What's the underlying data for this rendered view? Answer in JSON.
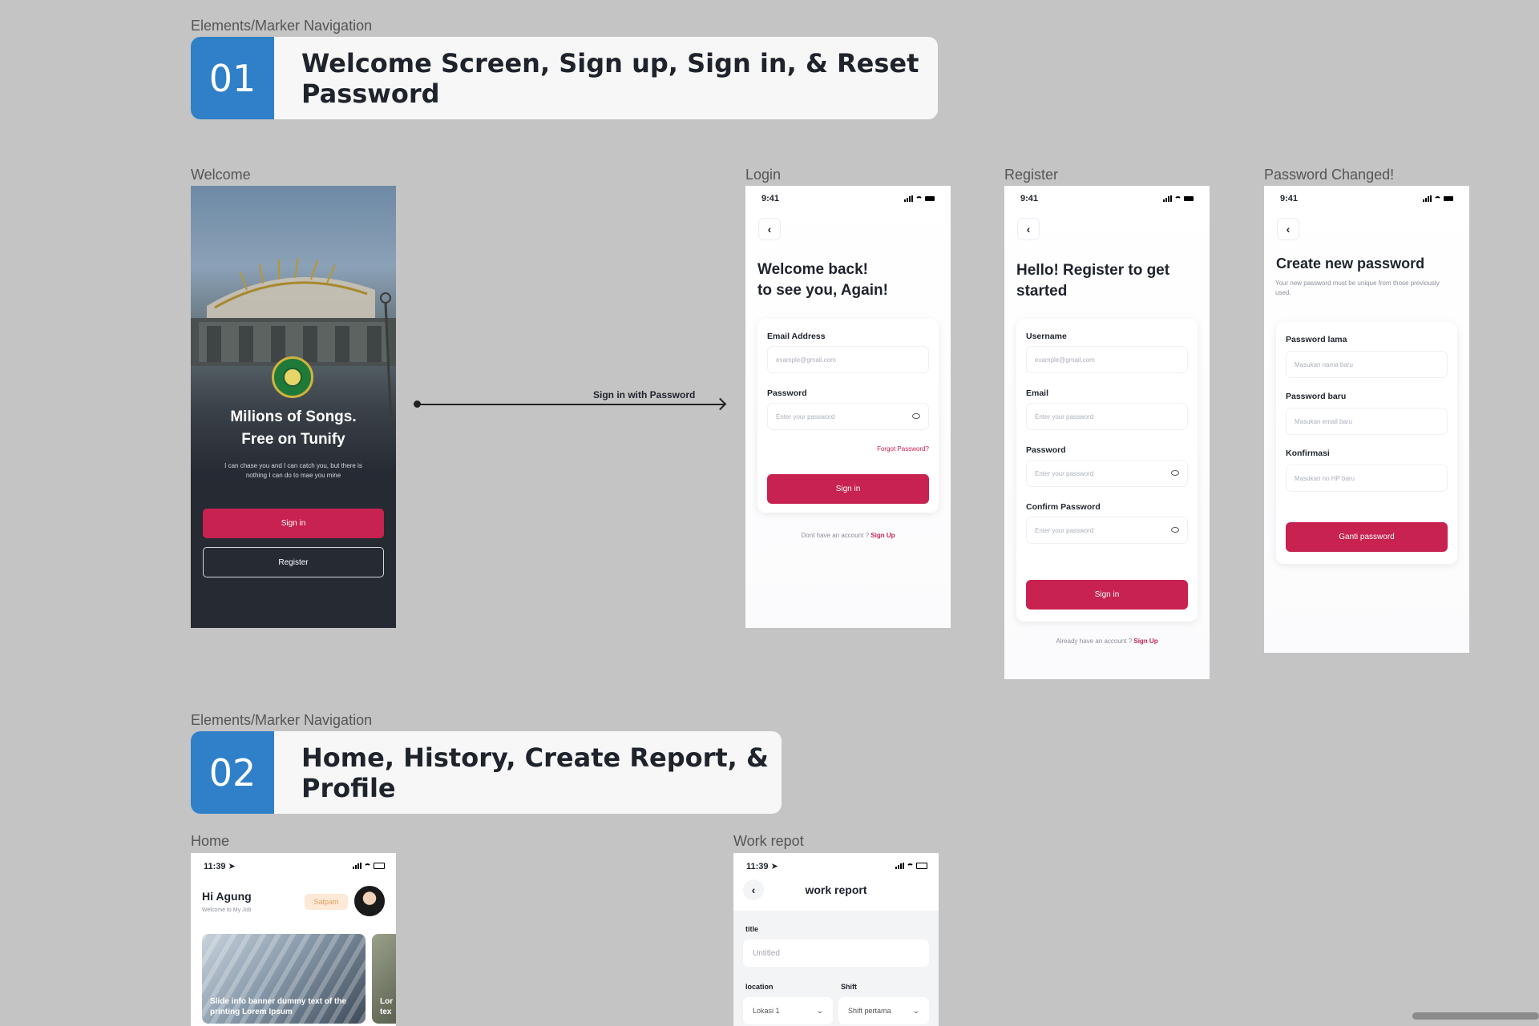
{
  "section1": {
    "label": "Elements/Marker Navigation",
    "number": "01",
    "title": "Welcome Screen, Sign up, Sign in, & Reset Password"
  },
  "section2": {
    "label": "Elements/Marker Navigation",
    "number": "02",
    "title": "Home, History, Create Report, & Profile"
  },
  "welcome": {
    "frame_label": "Welcome",
    "headline_line1": "Milions of Songs.",
    "headline_line2": "Free on Tunify",
    "subtitle": "I can chase you and I can catch you, but there is nothing I can do to mae you mine",
    "signin_label": "Sign in",
    "register_label": "Register"
  },
  "connector": {
    "label": "Sign in with Password"
  },
  "login": {
    "frame_label": "Login",
    "time": "9:41",
    "heading_line1": "Welcome back!",
    "heading_line2": "to see you, Again!",
    "email_label": "Email Address",
    "email_placeholder": "example@gmail.com",
    "password_label": "Password",
    "password_placeholder": "Enter your password",
    "forgot": "Forgot Password?",
    "signin_label": "Sign in",
    "footer_text": "Dont have an account ?",
    "footer_link": "Sign Up"
  },
  "register": {
    "frame_label": "Register",
    "time": "9:41",
    "heading_line1": "Hello! Register to get",
    "heading_line2": "started",
    "username_label": "Username",
    "username_placeholder": "example@gmail.com",
    "email_label": "Email",
    "email_placeholder": "Enter your password",
    "password_label": "Password",
    "password_placeholder": "Enter your password",
    "confirm_label": "Confirm Password",
    "confirm_placeholder": "Enter your password",
    "signin_label": "Sign in",
    "footer_text": "Already have an account ?",
    "footer_link": "Sign Up"
  },
  "password_changed": {
    "frame_label": "Password Changed!",
    "time": "9:41",
    "heading": "Create new password",
    "subtitle": "Your new password must be unique from those previously used.",
    "old_label": "Password lama",
    "old_placeholder": "Masukan nama baru",
    "new_label": "Password baru",
    "new_placeholder": "Masukan email baru",
    "confirm_label": "Konfirmasi",
    "confirm_placeholder": "Masukan no HP baru",
    "button_label": "Ganti password"
  },
  "home": {
    "frame_label": "Home",
    "time": "11:39",
    "greeting": "Hi Agung",
    "welcome_sub": "Welcome to My Job",
    "badge": "Satpam",
    "banner_text": "Slide info banner dummy text of the printing Lorem Ipsum",
    "banner2_text": "Lor tex"
  },
  "work_report": {
    "frame_label": "Work repot",
    "time": "11:39",
    "title": "work report",
    "title_label": "title",
    "title_placeholder": "Untitled",
    "location_label": "location",
    "location_value": "Lokasi 1",
    "shift_label": "Shift",
    "shift_value": "Shift pertama"
  },
  "colors": {
    "accent": "#c72250",
    "marker_blue": "#2f80c8",
    "canvas": "#c4c4c4",
    "dark_bg": "#252a33"
  }
}
